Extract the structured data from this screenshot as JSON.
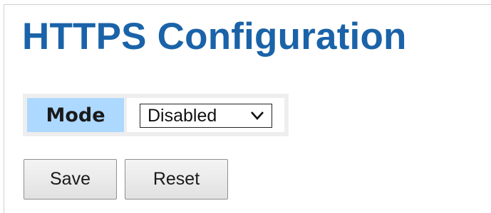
{
  "page": {
    "title": "HTTPS Configuration"
  },
  "form": {
    "mode_label": "Mode",
    "mode_value": "Disabled",
    "mode_options": [
      "Disabled"
    ]
  },
  "buttons": {
    "save_label": "Save",
    "reset_label": "Reset"
  },
  "colors": {
    "title": "#1a63a8",
    "label_cell_bg": "#add8ff",
    "table_bg": "#eeeeee"
  },
  "icons": {
    "select_arrow": "chevron-down-icon"
  }
}
